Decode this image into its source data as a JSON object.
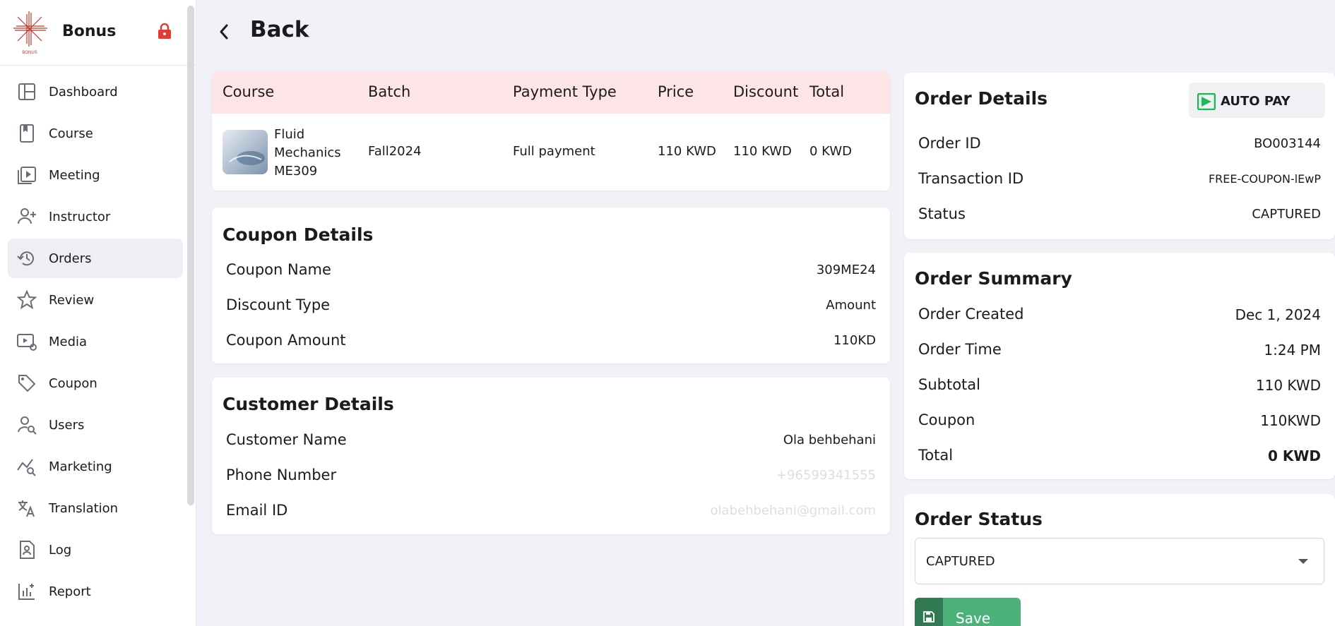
{
  "sidebar": {
    "brand": "Bonus",
    "logo_text": "BONUS",
    "items": [
      {
        "label": "Dashboard",
        "icon": "dashboard-icon"
      },
      {
        "label": "Course",
        "icon": "book-icon"
      },
      {
        "label": "Meeting",
        "icon": "video-icon"
      },
      {
        "label": "Instructor",
        "icon": "user-add-icon"
      },
      {
        "label": "Orders",
        "icon": "history-icon",
        "active": true
      },
      {
        "label": "Review",
        "icon": "star-icon"
      },
      {
        "label": "Media",
        "icon": "media-settings-icon"
      },
      {
        "label": "Coupon",
        "icon": "tag-icon"
      },
      {
        "label": "Users",
        "icon": "user-search-icon"
      },
      {
        "label": "Marketing",
        "icon": "chart-search-icon"
      },
      {
        "label": "Translation",
        "icon": "translate-icon"
      },
      {
        "label": "Log",
        "icon": "log-icon"
      },
      {
        "label": "Report",
        "icon": "report-icon"
      }
    ]
  },
  "header": {
    "back_label": "Back"
  },
  "course_table": {
    "headers": [
      "Course",
      "Batch",
      "Payment Type",
      "Price",
      "Discount",
      "Total"
    ],
    "row": {
      "course": "Fluid Mechanics ME309",
      "batch": "Fall2024",
      "payment_type": "Full payment",
      "price": "110 KWD",
      "discount": "110 KWD",
      "total": "0 KWD"
    }
  },
  "coupon": {
    "title": "Coupon Details",
    "rows": [
      {
        "label": "Coupon Name",
        "value": "309ME24"
      },
      {
        "label": "Discount Type",
        "value": "Amount"
      },
      {
        "label": "Coupon Amount",
        "value": "110KD"
      }
    ]
  },
  "customer": {
    "title": "Customer Details",
    "rows": [
      {
        "label": "Customer Name",
        "value": "Ola behbehani"
      },
      {
        "label": "Phone Number",
        "value": "+96599341555"
      },
      {
        "label": "Email ID",
        "value": "olabehbehani@gmail.com"
      }
    ]
  },
  "order_details": {
    "title": "Order Details",
    "autopay_label": "AUTO PAY",
    "rows": [
      {
        "label": "Order ID",
        "value": "BO003144"
      },
      {
        "label": "Transaction ID",
        "value": "FREE-COUPON-lEwP"
      },
      {
        "label": "Status",
        "value": "CAPTURED"
      }
    ]
  },
  "order_summary": {
    "title": "Order Summary",
    "rows": [
      {
        "label": "Order Created",
        "value": "Dec 1, 2024"
      },
      {
        "label": "Order Time",
        "value": "1:24 PM"
      },
      {
        "label": "Subtotal",
        "value": "110 KWD"
      },
      {
        "label": "Coupon",
        "value": "110KWD"
      },
      {
        "label": "Total",
        "value": "0 KWD"
      }
    ]
  },
  "order_status": {
    "title": "Order Status",
    "selected": "CAPTURED",
    "save_label": "Save"
  },
  "colors": {
    "accent_green": "#4cb27a",
    "table_header_pink": "#fde4e6",
    "lock_red": "#e53935"
  }
}
